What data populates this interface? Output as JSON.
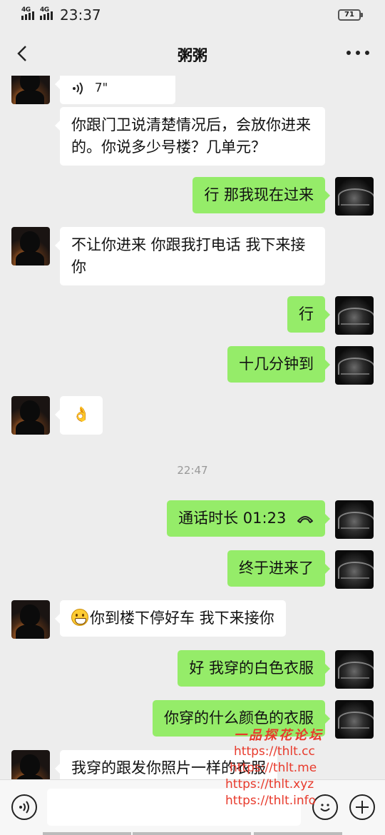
{
  "status_bar": {
    "signal1": "4G",
    "signal2": "4G",
    "time": "23:37",
    "battery": "71"
  },
  "header": {
    "title": "粥粥"
  },
  "messages": [
    {
      "side": "left",
      "type": "voice",
      "duration": "7\""
    },
    {
      "side": "left",
      "type": "text",
      "text": "你跟门卫说清楚情况后，会放你进来的。你说多少号楼？几单元？"
    },
    {
      "side": "right",
      "type": "text",
      "text": "行 那我现在过来"
    },
    {
      "side": "left",
      "type": "text",
      "text": "不让你进来 你跟我打电话 我下来接你"
    },
    {
      "side": "right",
      "type": "text",
      "text": "行"
    },
    {
      "side": "right",
      "type": "text",
      "text": "十几分钟到"
    },
    {
      "side": "left",
      "type": "emoji",
      "icon": "ok-hand-emoji"
    },
    {
      "type": "time",
      "text": "22:47"
    },
    {
      "side": "right",
      "type": "call",
      "text": "通话时长 01:23",
      "icon": "phone-hangup-icon"
    },
    {
      "side": "right",
      "type": "text",
      "text": "终于进来了"
    },
    {
      "side": "left",
      "type": "text",
      "text": "你到楼下停好车 我下来接你",
      "icon": "grin-emoji"
    },
    {
      "side": "right",
      "type": "text",
      "text": "好 我穿的白色衣服"
    },
    {
      "side": "right",
      "type": "text",
      "text": "你穿的什么颜色的衣服"
    },
    {
      "side": "left",
      "type": "text",
      "text": "我穿的跟发你照片一样的衣服"
    }
  ],
  "watermark": {
    "title": "一品探花论坛",
    "urls": [
      "https://thlt.cc",
      "https://thlt.me",
      "https://thlt.xyz",
      "https://thlt.info"
    ]
  },
  "input_bar": {
    "placeholder": ""
  },
  "colors": {
    "background": "#ededed",
    "bubble_sent": "#95ec69",
    "bubble_received": "#ffffff",
    "watermark": "#e83a2c"
  }
}
